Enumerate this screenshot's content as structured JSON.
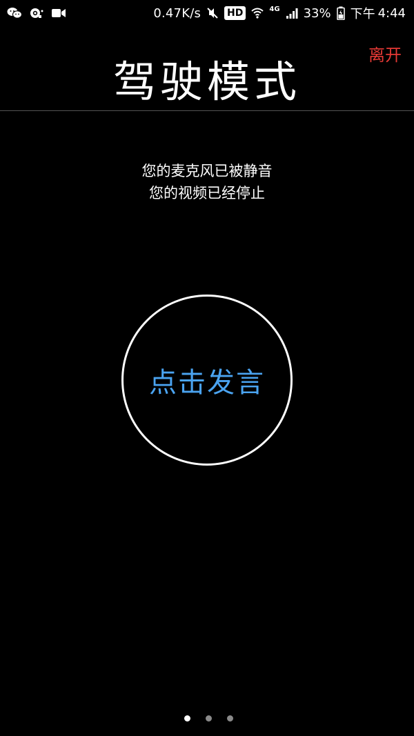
{
  "status_bar": {
    "left_icons": [
      "wechat-icon",
      "qq-icon",
      "video-call-icon"
    ],
    "net_speed": "0.47K/s",
    "hd_label": "HD",
    "network_type": "4G",
    "battery_percent": "33%",
    "period": "下午",
    "time": "4:44"
  },
  "header": {
    "title": "驾驶模式",
    "leave_label": "离开"
  },
  "messages": {
    "mic_status": "您的麦克风已被静音",
    "video_status": "您的视频已经停止"
  },
  "talk_button": {
    "label": "点击发言"
  },
  "page_indicator": {
    "total": 3,
    "active": 1
  },
  "colors": {
    "background": "#000000",
    "leave": "#e53935",
    "talk_label": "#4aa3f0",
    "divider": "#555555"
  }
}
